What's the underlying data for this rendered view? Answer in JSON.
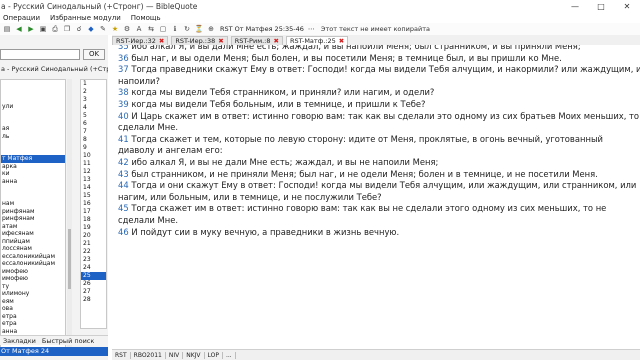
{
  "window": {
    "title": "а - Русский Синодальный (+Стронг) — BibleQuote",
    "minimize_icon": "minimize-icon",
    "maximize_icon": "maximize-icon",
    "close_icon": "close-icon"
  },
  "menu": [
    "Операции",
    "Избранные модули",
    "Помощь"
  ],
  "toolbar": {
    "reference": "RST От Матфея 25:35-46",
    "note": "Этот текст не имеет копирайта"
  },
  "left": {
    "ok_label": "OK",
    "module_label": "а - Русский Синодальный (+Стронг)",
    "books": [
      "",
      "",
      "",
      "ули",
      "",
      "",
      "ая",
      "ль",
      "",
      "",
      "т Матфея",
      "арка",
      "ки",
      "анна",
      "",
      "",
      "нам",
      "ринфянам",
      "ринфянам",
      "атам",
      "ифесянам",
      "ппийцам",
      "лоссянам",
      "ессалоникийцам",
      "ессалоникийцам",
      "имофею",
      "имофею",
      "ту",
      "илимону",
      "еям",
      "ова",
      "етра",
      "етра",
      "анна",
      "анна",
      "",
      "да",
      "ние"
    ],
    "selected_book_index": 10,
    "chapters": [
      "1",
      "2",
      "3",
      "4",
      "5",
      "6",
      "7",
      "8",
      "9",
      "10",
      "11",
      "12",
      "13",
      "14",
      "15",
      "16",
      "17",
      "18",
      "19",
      "20",
      "21",
      "22",
      "23",
      "24",
      "25",
      "26",
      "27",
      "28"
    ],
    "selected_chapter_index": 24,
    "tabs": [
      "Закладки",
      "Быстрый поиск"
    ],
    "history_item": "От Матфея 24"
  },
  "tabs": [
    {
      "label": "RST-Иер.:32",
      "active": false
    },
    {
      "label": "RST-Иер.:38",
      "active": false
    },
    {
      "label": "RST-Рим.:8",
      "active": false
    },
    {
      "label": "RST-Матф.:25",
      "active": true
    }
  ],
  "verses": [
    {
      "num": "35",
      "text": "ибо алкал Я, и вы дали Мне есть; жаждал, и вы напоили Меня; был странником, и вы приняли Меня;"
    },
    {
      "num": "36",
      "text": "был наг, и вы одели Меня; был болен, и вы посетили Меня; в темнице был, и вы пришли ко Мне."
    },
    {
      "num": "37",
      "text": "Тогда праведники скажут Ему в ответ: Господи! когда мы видели Тебя алчущим, и накормили? или жаждущим, и"
    },
    {
      "num": "",
      "text": "напоили?"
    },
    {
      "num": "38",
      "text": "когда мы видели Тебя странником, и приняли? или нагим, и одели?"
    },
    {
      "num": "39",
      "text": "когда мы видели Тебя больным, или в темнице, и пришли к Тебе?"
    },
    {
      "num": "40",
      "text": "И Царь скажет им в ответ: истинно говорю вам: так как вы сделали это одному из сих братьев Моих меньших, то"
    },
    {
      "num": "",
      "text": "сделали Мне."
    },
    {
      "num": "41",
      "text": "Тогда скажет и тем, которые по левую сторону: идите от Меня, проклятые, в огонь вечный, уготованный"
    },
    {
      "num": "",
      "text": "диаволу и ангелам его:"
    },
    {
      "num": "42",
      "text": "ибо алкал Я, и вы не дали Мне есть; жаждал, и вы не напоили Меня;"
    },
    {
      "num": "43",
      "text": "был странником, и не приняли Меня; был наг, и не одели Меня; болен и в темнице, и не посетили Меня."
    },
    {
      "num": "44",
      "text": "Тогда и они скажут Ему в ответ: Господи! когда мы видели Тебя алчущим, или жаждущим, или странником, или"
    },
    {
      "num": "",
      "text": "нагим, или больным, или в темнице, и не послужили Тебе?"
    },
    {
      "num": "45",
      "text": "Тогда скажет им в ответ: истинно говорю вам: так как вы не сделали этого одному из сих меньших, то не"
    },
    {
      "num": "",
      "text": "сделали Мне."
    },
    {
      "num": "46",
      "text": "И пойдут сии в муку вечную, а праведники в жизнь вечную."
    }
  ],
  "module_tabs": [
    "RST",
    "RBO2011",
    "NIV",
    "NKJV",
    "LOP",
    "..."
  ],
  "colors": {
    "verse_number": "#2b6ab5",
    "selection": "#1e62c6",
    "tab_close": "#d21e1e"
  }
}
